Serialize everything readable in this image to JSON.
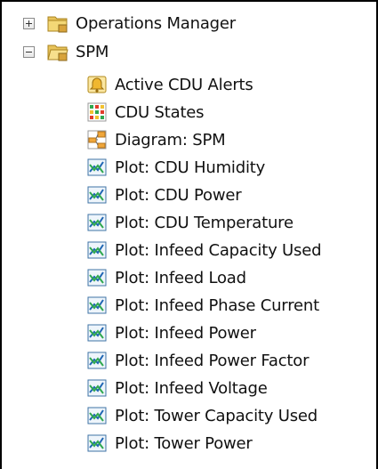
{
  "tree": {
    "folders": [
      {
        "label": "Operations Manager",
        "expanded": false,
        "icon": "folder-icon"
      },
      {
        "label": "SPM",
        "expanded": true,
        "icon": "folder-open-icon"
      }
    ],
    "spm_children": [
      {
        "label": "Active CDU Alerts",
        "icon": "alert-icon"
      },
      {
        "label": "CDU States",
        "icon": "state-grid-icon"
      },
      {
        "label": "Diagram: SPM",
        "icon": "diagram-icon"
      },
      {
        "label": "Plot: CDU Humidity",
        "icon": "plot-icon"
      },
      {
        "label": "Plot: CDU Power",
        "icon": "plot-icon"
      },
      {
        "label": "Plot: CDU Temperature",
        "icon": "plot-icon"
      },
      {
        "label": "Plot: Infeed Capacity Used",
        "icon": "plot-icon"
      },
      {
        "label": "Plot: Infeed Load",
        "icon": "plot-icon"
      },
      {
        "label": "Plot: Infeed Phase Current",
        "icon": "plot-icon"
      },
      {
        "label": "Plot: Infeed Power",
        "icon": "plot-icon"
      },
      {
        "label": "Plot: Infeed Power Factor",
        "icon": "plot-icon"
      },
      {
        "label": "Plot: Infeed Voltage",
        "icon": "plot-icon"
      },
      {
        "label": "Plot: Tower Capacity Used",
        "icon": "plot-icon"
      },
      {
        "label": "Plot: Tower Power",
        "icon": "plot-icon"
      }
    ]
  }
}
